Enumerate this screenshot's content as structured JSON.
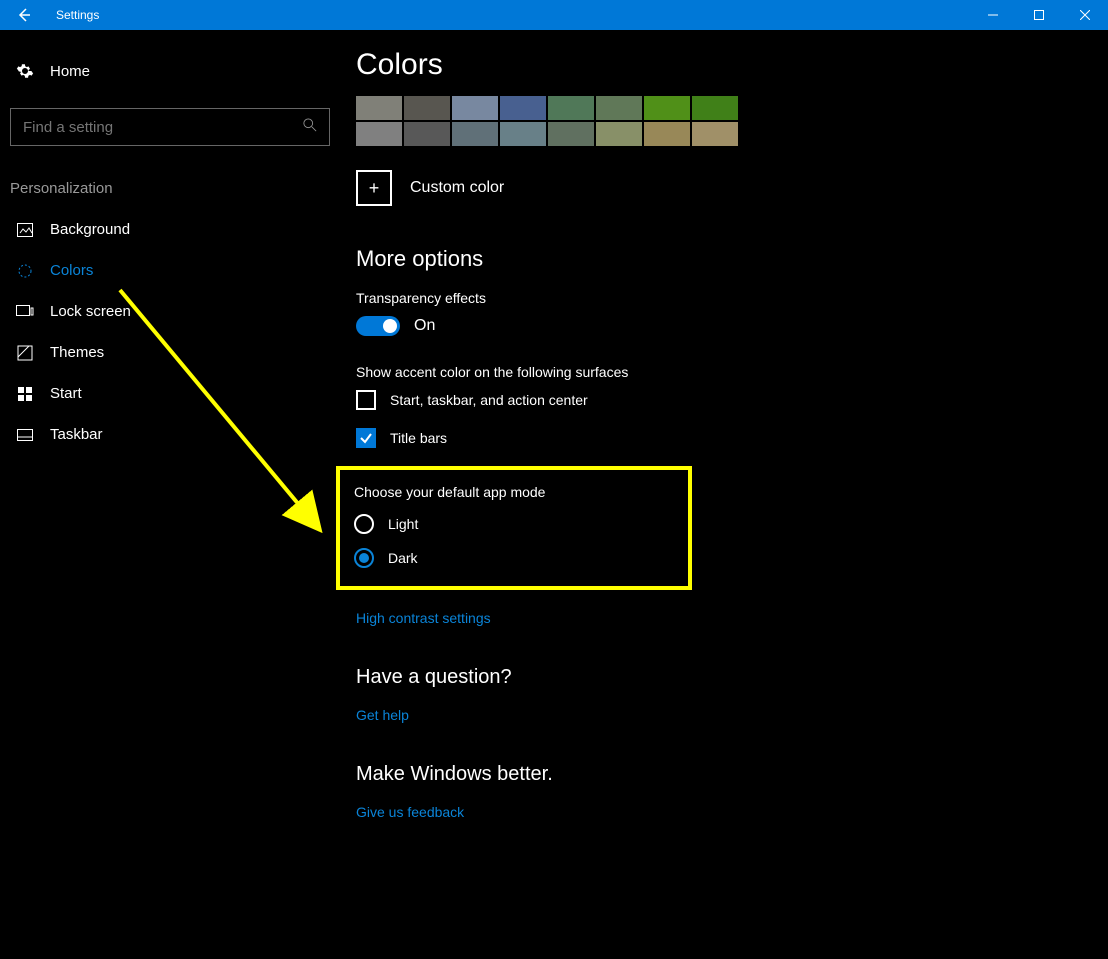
{
  "window": {
    "title": "Settings"
  },
  "sidebar": {
    "home": "Home",
    "search_placeholder": "Find a setting",
    "section": "Personalization",
    "items": [
      {
        "label": "Background"
      },
      {
        "label": "Colors"
      },
      {
        "label": "Lock screen"
      },
      {
        "label": "Themes"
      },
      {
        "label": "Start"
      },
      {
        "label": "Taskbar"
      }
    ]
  },
  "main": {
    "title": "Colors",
    "swatches_row1": [
      "#808078",
      "#585650",
      "#7888a0",
      "#486090",
      "#507858",
      "#607858",
      "#509018",
      "#408018"
    ],
    "swatches_row2": [
      "#808080",
      "#585858",
      "#607078",
      "#688088",
      "#607060",
      "#889068",
      "#988858",
      "#a09068"
    ],
    "custom_color": "Custom color",
    "more_options": "More options",
    "transparency_label": "Transparency effects",
    "transparency_state": "On",
    "accent_surfaces_label": "Show accent color on the following surfaces",
    "cb_start": "Start, taskbar, and action center",
    "cb_title": "Title bars",
    "app_mode_label": "Choose your default app mode",
    "radio_light": "Light",
    "radio_dark": "Dark",
    "high_contrast": "High contrast settings",
    "have_question": "Have a question?",
    "get_help": "Get help",
    "make_better": "Make Windows better.",
    "feedback": "Give us feedback"
  },
  "annotation": {
    "highlight_color": "#ffff00"
  }
}
